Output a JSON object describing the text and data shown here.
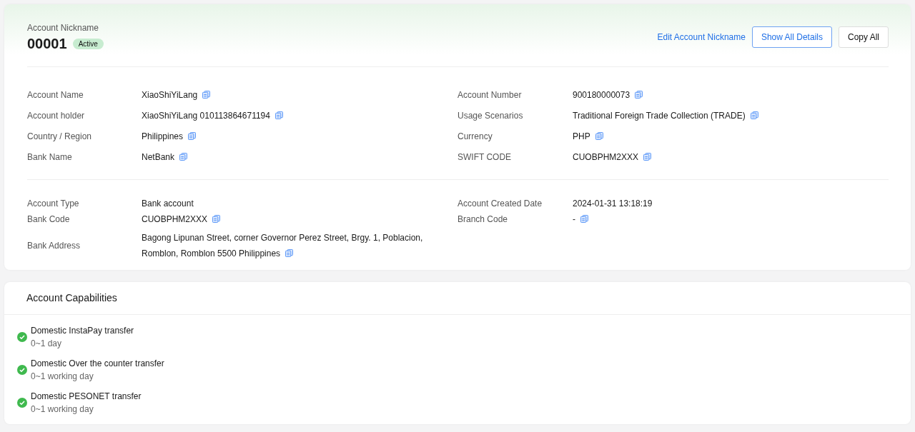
{
  "header": {
    "label": "Account Nickname",
    "nickname": "00001",
    "status": "Active",
    "edit_link": "Edit Account Nickname",
    "buttons": [
      {
        "label": "Show All Details",
        "kind": "primary"
      },
      {
        "label": "Copy All",
        "kind": "default"
      }
    ]
  },
  "sections": [
    {
      "rows": [
        {
          "fields": [
            {
              "label": "Account Name",
              "value": "XiaoShiYiLang",
              "copyable": true
            },
            {
              "label": "Account Number",
              "value": "900180000073",
              "copyable": true
            }
          ]
        },
        {
          "fields": [
            {
              "label": "Account holder",
              "value": "XiaoShiYiLang 010113864671194",
              "copyable": true
            },
            {
              "label": "Usage Scenarios",
              "value": "Traditional Foreign Trade Collection (TRADE)",
              "copyable": true
            }
          ]
        },
        {
          "fields": [
            {
              "label": "Country / Region",
              "value": "Philippines",
              "copyable": true
            },
            {
              "label": "Currency",
              "value": "PHP",
              "copyable": true
            }
          ]
        },
        {
          "fields": [
            {
              "label": "Bank Name",
              "value": "NetBank",
              "copyable": true
            },
            {
              "label": "SWIFT CODE",
              "value": "CUOBPHM2XXX",
              "copyable": true
            }
          ]
        }
      ]
    },
    {
      "rows": [
        {
          "fields": [
            {
              "label": "Account Type",
              "value": "Bank account",
              "copyable": false
            },
            {
              "label": "Account Created Date",
              "value": "2024-01-31 13:18:19",
              "copyable": false
            }
          ]
        },
        {
          "fields": [
            {
              "label": "Bank Code",
              "value": "CUOBPHM2XXX",
              "copyable": true
            },
            {
              "label": "Branch Code",
              "value": "-",
              "copyable": true
            }
          ]
        },
        {
          "fields": [
            {
              "label": "Bank Address",
              "value": "Bagong Lipunan Street, corner Governor Perez Street, Brgy. 1, Poblacion, Romblon, Romblon 5500 Philippines",
              "copyable": true
            }
          ]
        }
      ]
    }
  ],
  "capabilities": {
    "title": "Account Capabilities",
    "items": [
      {
        "name": "Domestic InstaPay transfer",
        "time": "0~1 day",
        "available": true
      },
      {
        "name": "Domestic Over the counter transfer",
        "time": "0~1 working day",
        "available": true
      },
      {
        "name": "Domestic PESONET transfer",
        "time": "0~1 working day",
        "available": true
      }
    ]
  }
}
